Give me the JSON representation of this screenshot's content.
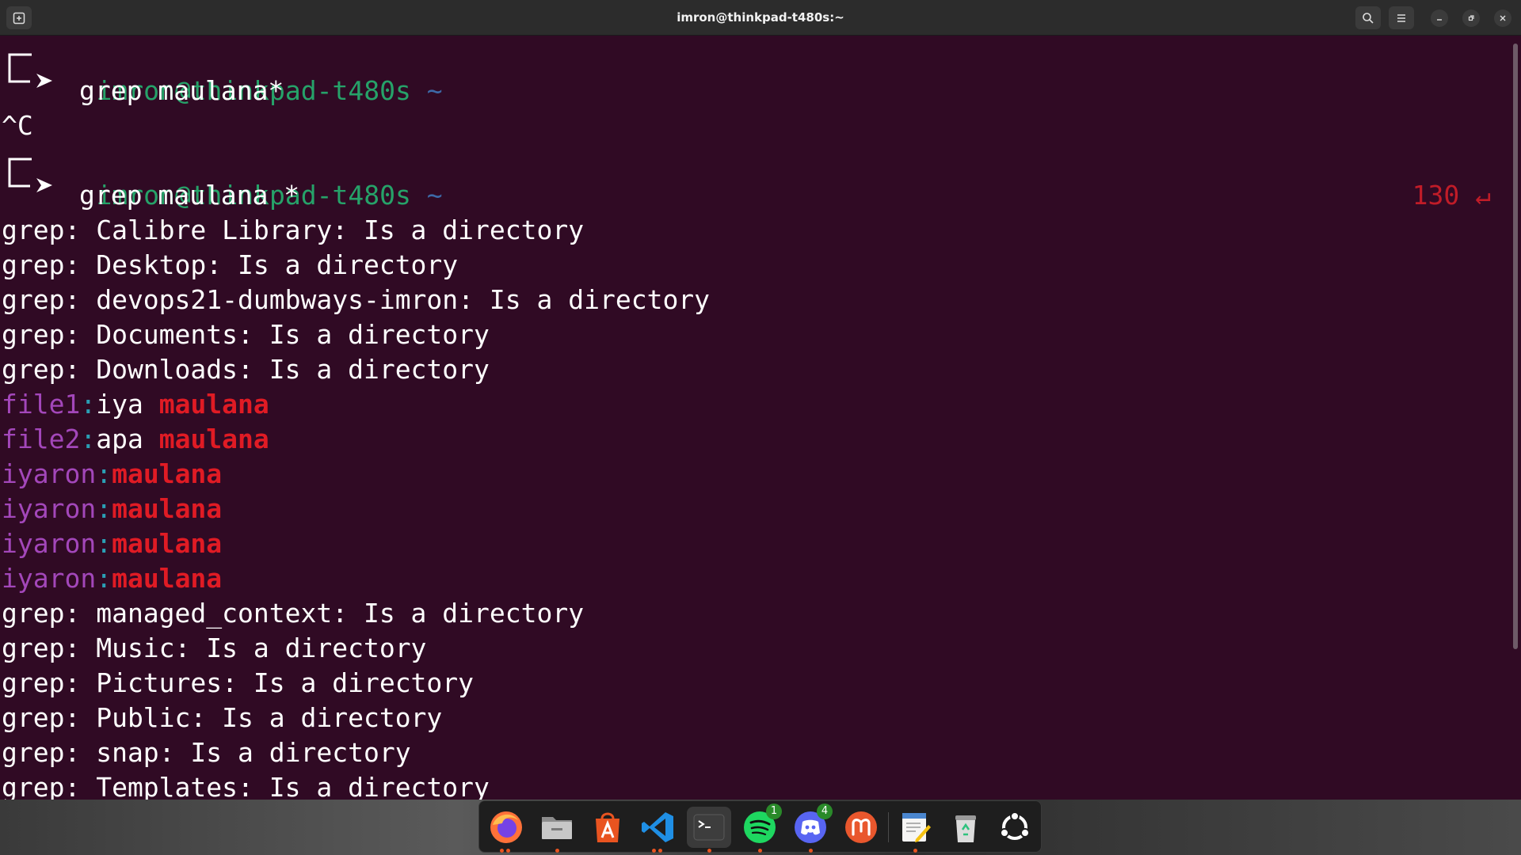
{
  "window": {
    "title": "imron@thinkpad-t480s:~"
  },
  "terminal": {
    "prompt1": {
      "user": "imron@thinkpad-t480s",
      "tilde": "~",
      "command": "grep maulana*"
    },
    "interrupt": "^C",
    "prompt2": {
      "user": "imron@thinkpad-t480s",
      "tilde": "~",
      "command": "grep maulana *",
      "exit_code": "130 ↵"
    },
    "lines_dir_a": [
      "grep: Calibre Library: Is a directory",
      "grep: Desktop: Is a directory",
      "grep: devops21-dumbways-imron: Is a directory",
      "grep: Documents: Is a directory",
      "grep: Downloads: Is a directory"
    ],
    "matches": [
      {
        "file": "file1",
        "sep": ":",
        "pre": "iya ",
        "match": "maulana"
      },
      {
        "file": "file2",
        "sep": ":",
        "pre": "apa ",
        "match": "maulana"
      },
      {
        "file": "iyaron",
        "sep": ":",
        "pre": "",
        "match": "maulana"
      },
      {
        "file": "iyaron",
        "sep": ":",
        "pre": "",
        "match": "maulana"
      },
      {
        "file": "iyaron",
        "sep": ":",
        "pre": "",
        "match": "maulana"
      },
      {
        "file": "iyaron",
        "sep": ":",
        "pre": "",
        "match": "maulana"
      }
    ],
    "lines_dir_b": [
      "grep: managed_context: Is a directory",
      "grep: Music: Is a directory",
      "grep: Pictures: Is a directory",
      "grep: Public: Is a directory",
      "grep: snap: Is a directory",
      "grep: Templates: Is a directory"
    ]
  },
  "dock": {
    "items": [
      {
        "name": "firefox-icon",
        "running": true
      },
      {
        "name": "files-icon",
        "running": true
      },
      {
        "name": "app-center-icon",
        "running": false
      },
      {
        "name": "vscode-icon",
        "running": true
      },
      {
        "name": "terminal-icon",
        "running": true
      },
      {
        "name": "spotify-icon",
        "running": true,
        "badge": "1"
      },
      {
        "name": "discord-icon",
        "running": true,
        "badge": "4"
      },
      {
        "name": "mastodon-icon",
        "running": false
      },
      {
        "name": "text-editor-icon",
        "running": true
      },
      {
        "name": "trash-icon",
        "running": false
      },
      {
        "name": "show-apps-icon",
        "running": false
      }
    ]
  },
  "colors": {
    "terminal_bg": "#300a24",
    "prompt_user": "#26a269",
    "filename": "#a347ba",
    "match": "#e01b24"
  }
}
